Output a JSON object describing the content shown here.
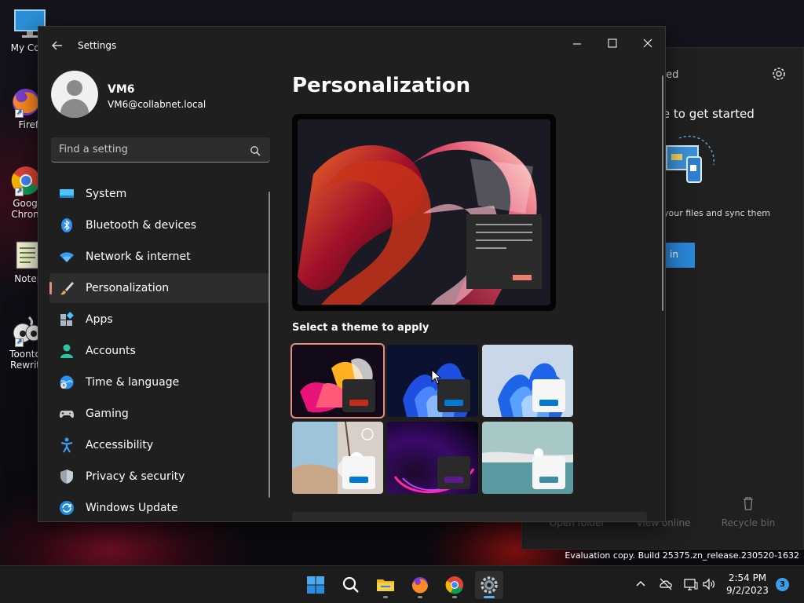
{
  "desktop": {
    "icons": [
      {
        "label": "My Com",
        "icon": "monitor-icon"
      },
      {
        "label": "Firefo",
        "icon": "firefox-icon"
      },
      {
        "label": "Goog Chron",
        "icon": "chrome-icon"
      },
      {
        "label": "Notepa",
        "icon": "notepad-icon"
      },
      {
        "label": "Toonto Rewrit",
        "icon": "toontown-icon"
      }
    ],
    "eval_text": "Evaluation copy. Build 25375.zn_release.230520-1632"
  },
  "onedrive": {
    "title": "ted",
    "heading": "ve to get started",
    "text": "your files and sync them",
    "button": "in",
    "footer": [
      "Open folder",
      "View online",
      "Recycle bin"
    ]
  },
  "settings": {
    "title": "Settings",
    "user": {
      "name": "VM6",
      "email": "VM6@collabnet.local"
    },
    "search": {
      "placeholder": "Find a setting"
    },
    "nav": [
      {
        "label": "System",
        "icon": "system-icon",
        "selected": false
      },
      {
        "label": "Bluetooth & devices",
        "icon": "bluetooth-icon",
        "selected": false
      },
      {
        "label": "Network & internet",
        "icon": "wifi-icon",
        "selected": false
      },
      {
        "label": "Personalization",
        "icon": "brush-icon",
        "selected": true
      },
      {
        "label": "Apps",
        "icon": "apps-icon",
        "selected": false
      },
      {
        "label": "Accounts",
        "icon": "accounts-icon",
        "selected": false
      },
      {
        "label": "Time & language",
        "icon": "time-language-icon",
        "selected": false
      },
      {
        "label": "Gaming",
        "icon": "gamepad-icon",
        "selected": false
      },
      {
        "label": "Accessibility",
        "icon": "accessibility-icon",
        "selected": false
      },
      {
        "label": "Privacy & security",
        "icon": "shield-icon",
        "selected": false
      },
      {
        "label": "Windows Update",
        "icon": "update-icon",
        "selected": false
      }
    ],
    "page_title": "Personalization",
    "themes_label": "Select a theme to apply",
    "themes": [
      {
        "name": "glow-dark",
        "accent": "#c42b1c",
        "card": "dark",
        "selected": true
      },
      {
        "name": "bloom-dark",
        "accent": "#0078d4",
        "card": "dark",
        "selected": false
      },
      {
        "name": "bloom-light",
        "accent": "#0078d4",
        "card": "light",
        "selected": false
      },
      {
        "name": "spotlight",
        "accent": "#0078d4",
        "card": "light",
        "selected": false
      },
      {
        "name": "captured-motion",
        "accent": "#5c1a8f",
        "card": "dark",
        "selected": false
      },
      {
        "name": "flow",
        "accent": "#3e8ea5",
        "card": "light",
        "selected": false
      }
    ]
  },
  "taskbar": {
    "apps": [
      "start-icon",
      "search-icon",
      "file-explorer-icon",
      "firefox-icon",
      "chrome-icon",
      "settings-icon"
    ],
    "time": "2:54 PM",
    "date": "9/2/2023",
    "notifications": "3"
  },
  "colors": {
    "accent": "#e38e7f",
    "window_bg": "#1f1f1f",
    "taskbar_bg": "#1c1c1c"
  }
}
